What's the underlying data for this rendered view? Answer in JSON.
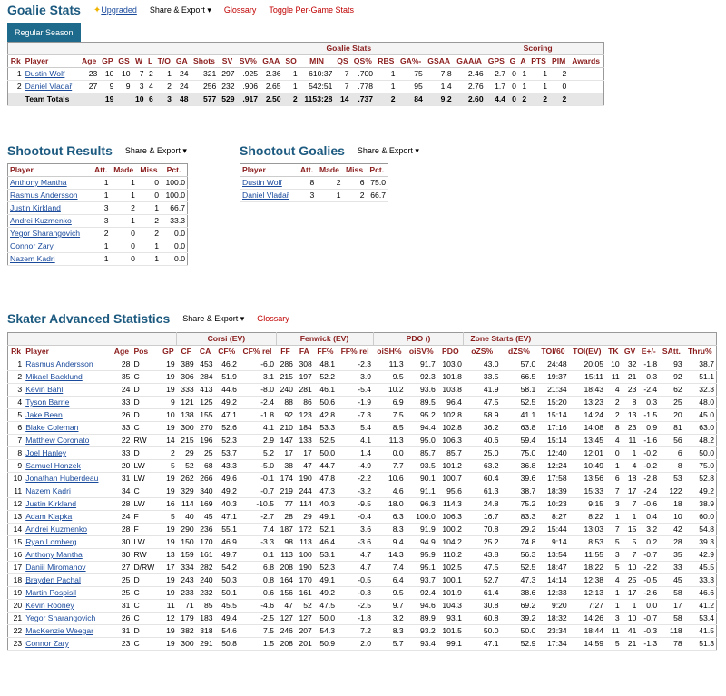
{
  "goalie": {
    "title": "Goalie Stats",
    "upgraded": "Upgraded",
    "share": "Share & Export ▾",
    "glossary": "Glossary",
    "toggle": "Toggle Per-Game Stats",
    "tab": "Regular Season",
    "group1": "Goalie Stats",
    "group2": "Scoring",
    "cols": [
      "Rk",
      "Player",
      "Age",
      "GP",
      "GS",
      "W",
      "L",
      "T/O",
      "GA",
      "Shots",
      "SV",
      "SV%",
      "GAA",
      "SO",
      "MIN",
      "QS",
      "QS%",
      "RBS",
      "GA%-",
      "GSAA",
      "GAA/A",
      "GPS",
      "G",
      "A",
      "PTS",
      "PIM",
      "Awards"
    ],
    "rows": [
      [
        "1",
        "Dustin Wolf",
        "23",
        "10",
        "10",
        "7",
        "2",
        "1",
        "24",
        "321",
        "297",
        ".925",
        "2.36",
        "1",
        "610:37",
        "7",
        ".700",
        "1",
        "75",
        "7.8",
        "2.46",
        "2.7",
        "0",
        "1",
        "1",
        "2",
        ""
      ],
      [
        "2",
        "Daniel Vladař",
        "27",
        "9",
        "9",
        "3",
        "4",
        "2",
        "24",
        "256",
        "232",
        ".906",
        "2.65",
        "1",
        "542:51",
        "7",
        ".778",
        "1",
        "95",
        "1.4",
        "2.76",
        "1.7",
        "0",
        "1",
        "1",
        "0",
        ""
      ]
    ],
    "totals": [
      "",
      "Team Totals",
      "",
      "19",
      "",
      "10",
      "6",
      "3",
      "48",
      "577",
      "529",
      ".917",
      "2.50",
      "2",
      "1153:28",
      "14",
      ".737",
      "2",
      "84",
      "9.2",
      "2.60",
      "4.4",
      "0",
      "2",
      "2",
      "2",
      ""
    ]
  },
  "shootout": {
    "title": "Shootout Results",
    "share": "Share & Export ▾",
    "cols": [
      "Player",
      "Att.",
      "Made",
      "Miss",
      "Pct."
    ],
    "rows": [
      [
        "Anthony Mantha",
        "1",
        "1",
        "0",
        "100.0"
      ],
      [
        "Rasmus Andersson",
        "1",
        "1",
        "0",
        "100.0"
      ],
      [
        "Justin Kirkland",
        "3",
        "2",
        "1",
        "66.7"
      ],
      [
        "Andrei Kuzmenko",
        "3",
        "1",
        "2",
        "33.3"
      ],
      [
        "Yegor Sharangovich",
        "2",
        "0",
        "2",
        "0.0"
      ],
      [
        "Connor Zary",
        "1",
        "0",
        "1",
        "0.0"
      ],
      [
        "Nazem Kadri",
        "1",
        "0",
        "1",
        "0.0"
      ]
    ]
  },
  "shootout_goalies": {
    "title": "Shootout Goalies",
    "share": "Share & Export ▾",
    "cols": [
      "Player",
      "Att.",
      "Made",
      "Miss",
      "Pct."
    ],
    "rows": [
      [
        "Dustin Wolf",
        "8",
        "2",
        "6",
        "75.0"
      ],
      [
        "Daniel Vladař",
        "3",
        "1",
        "2",
        "66.7"
      ]
    ]
  },
  "skater": {
    "title": "Skater Advanced Statistics",
    "share": "Share & Export ▾",
    "glossary": "Glossary",
    "groups": [
      "Corsi (EV)",
      "Fenwick (EV)",
      "PDO ()",
      "Zone Starts (EV)"
    ],
    "cols": [
      "Rk",
      "Player",
      "Age",
      "Pos",
      "GP",
      "CF",
      "CA",
      "CF%",
      "CF% rel",
      "FF",
      "FA",
      "FF%",
      "FF% rel",
      "oiSH%",
      "oiSV%",
      "PDO",
      "oZS%",
      "dZS%",
      "TOI/60",
      "TOI(EV)",
      "TK",
      "GV",
      "E+/-",
      "SAtt.",
      "Thru%"
    ],
    "rows": [
      [
        "1",
        "Rasmus Andersson",
        "28",
        "D",
        "19",
        "389",
        "453",
        "46.2",
        "-6.0",
        "286",
        "308",
        "48.1",
        "-2.3",
        "11.3",
        "91.7",
        "103.0",
        "43.0",
        "57.0",
        "24:48",
        "20:05",
        "10",
        "32",
        "-1.8",
        "93",
        "38.7"
      ],
      [
        "2",
        "Mikael Backlund",
        "35",
        "C",
        "19",
        "306",
        "284",
        "51.9",
        "3.1",
        "215",
        "197",
        "52.2",
        "3.9",
        "9.5",
        "92.3",
        "101.8",
        "33.5",
        "66.5",
        "19:37",
        "15:11",
        "11",
        "21",
        "0.3",
        "92",
        "51.1"
      ],
      [
        "3",
        "Kevin Bahl",
        "24",
        "D",
        "19",
        "333",
        "413",
        "44.6",
        "-8.0",
        "240",
        "281",
        "46.1",
        "-5.4",
        "10.2",
        "93.6",
        "103.8",
        "41.9",
        "58.1",
        "21:34",
        "18:43",
        "4",
        "23",
        "-2.4",
        "62",
        "32.3"
      ],
      [
        "4",
        "Tyson Barrie",
        "33",
        "D",
        "9",
        "121",
        "125",
        "49.2",
        "-2.4",
        "88",
        "86",
        "50.6",
        "-1.9",
        "6.9",
        "89.5",
        "96.4",
        "47.5",
        "52.5",
        "15:20",
        "13:23",
        "2",
        "8",
        "0.3",
        "25",
        "48.0"
      ],
      [
        "5",
        "Jake Bean",
        "26",
        "D",
        "10",
        "138",
        "155",
        "47.1",
        "-1.8",
        "92",
        "123",
        "42.8",
        "-7.3",
        "7.5",
        "95.2",
        "102.8",
        "58.9",
        "41.1",
        "15:14",
        "14:24",
        "2",
        "13",
        "-1.5",
        "20",
        "45.0"
      ],
      [
        "6",
        "Blake Coleman",
        "33",
        "C",
        "19",
        "300",
        "270",
        "52.6",
        "4.1",
        "210",
        "184",
        "53.3",
        "5.4",
        "8.5",
        "94.4",
        "102.8",
        "36.2",
        "63.8",
        "17:16",
        "14:08",
        "8",
        "23",
        "0.9",
        "81",
        "63.0"
      ],
      [
        "7",
        "Matthew Coronato",
        "22",
        "RW",
        "14",
        "215",
        "196",
        "52.3",
        "2.9",
        "147",
        "133",
        "52.5",
        "4.1",
        "11.3",
        "95.0",
        "106.3",
        "40.6",
        "59.4",
        "15:14",
        "13:45",
        "4",
        "11",
        "-1.6",
        "56",
        "48.2"
      ],
      [
        "8",
        "Joel Hanley",
        "33",
        "D",
        "2",
        "29",
        "25",
        "53.7",
        "5.2",
        "17",
        "17",
        "50.0",
        "1.4",
        "0.0",
        "85.7",
        "85.7",
        "25.0",
        "75.0",
        "12:40",
        "12:01",
        "0",
        "1",
        "-0.2",
        "6",
        "50.0"
      ],
      [
        "9",
        "Samuel Honzek",
        "20",
        "LW",
        "5",
        "52",
        "68",
        "43.3",
        "-5.0",
        "38",
        "47",
        "44.7",
        "-4.9",
        "7.7",
        "93.5",
        "101.2",
        "63.2",
        "36.8",
        "12:24",
        "10:49",
        "1",
        "4",
        "-0.2",
        "8",
        "75.0"
      ],
      [
        "10",
        "Jonathan Huberdeau",
        "31",
        "LW",
        "19",
        "262",
        "266",
        "49.6",
        "-0.1",
        "174",
        "190",
        "47.8",
        "-2.2",
        "10.6",
        "90.1",
        "100.7",
        "60.4",
        "39.6",
        "17:58",
        "13:56",
        "6",
        "18",
        "-2.8",
        "53",
        "52.8"
      ],
      [
        "11",
        "Nazem Kadri",
        "34",
        "C",
        "19",
        "329",
        "340",
        "49.2",
        "-0.7",
        "219",
        "244",
        "47.3",
        "-3.2",
        "4.6",
        "91.1",
        "95.6",
        "61.3",
        "38.7",
        "18:39",
        "15:33",
        "7",
        "17",
        "-2.4",
        "122",
        "49.2"
      ],
      [
        "12",
        "Justin Kirkland",
        "28",
        "LW",
        "16",
        "114",
        "169",
        "40.3",
        "-10.5",
        "77",
        "114",
        "40.3",
        "-9.5",
        "18.0",
        "96.3",
        "114.3",
        "24.8",
        "75.2",
        "10:23",
        "9:15",
        "3",
        "7",
        "-0.6",
        "18",
        "38.9"
      ],
      [
        "13",
        "Adam Klapka",
        "24",
        "F",
        "5",
        "40",
        "45",
        "47.1",
        "-2.7",
        "28",
        "29",
        "49.1",
        "-0.4",
        "6.3",
        "100.0",
        "106.3",
        "16.7",
        "83.3",
        "8:27",
        "8:22",
        "1",
        "1",
        "0.4",
        "10",
        "60.0"
      ],
      [
        "14",
        "Andrei Kuzmenko",
        "28",
        "F",
        "19",
        "290",
        "236",
        "55.1",
        "7.4",
        "187",
        "172",
        "52.1",
        "3.6",
        "8.3",
        "91.9",
        "100.2",
        "70.8",
        "29.2",
        "15:44",
        "13:03",
        "7",
        "15",
        "3.2",
        "42",
        "54.8"
      ],
      [
        "15",
        "Ryan Lomberg",
        "30",
        "LW",
        "19",
        "150",
        "170",
        "46.9",
        "-3.3",
        "98",
        "113",
        "46.4",
        "-3.6",
        "9.4",
        "94.9",
        "104.2",
        "25.2",
        "74.8",
        "9:14",
        "8:53",
        "5",
        "5",
        "0.2",
        "28",
        "39.3"
      ],
      [
        "16",
        "Anthony Mantha",
        "30",
        "RW",
        "13",
        "159",
        "161",
        "49.7",
        "0.1",
        "113",
        "100",
        "53.1",
        "4.7",
        "14.3",
        "95.9",
        "110.2",
        "43.8",
        "56.3",
        "13:54",
        "11:55",
        "3",
        "7",
        "-0.7",
        "35",
        "42.9"
      ],
      [
        "17",
        "Daniil Miromanov",
        "27",
        "D/RW",
        "17",
        "334",
        "282",
        "54.2",
        "6.8",
        "208",
        "190",
        "52.3",
        "4.7",
        "7.4",
        "95.1",
        "102.5",
        "47.5",
        "52.5",
        "18:47",
        "18:22",
        "5",
        "10",
        "-2.2",
        "33",
        "45.5"
      ],
      [
        "18",
        "Brayden Pachal",
        "25",
        "D",
        "19",
        "243",
        "240",
        "50.3",
        "0.8",
        "164",
        "170",
        "49.1",
        "-0.5",
        "6.4",
        "93.7",
        "100.1",
        "52.7",
        "47.3",
        "14:14",
        "12:38",
        "4",
        "25",
        "-0.5",
        "45",
        "33.3"
      ],
      [
        "19",
        "Martin Pospisil",
        "25",
        "C",
        "19",
        "233",
        "232",
        "50.1",
        "0.6",
        "156",
        "161",
        "49.2",
        "-0.3",
        "9.5",
        "92.4",
        "101.9",
        "61.4",
        "38.6",
        "12:33",
        "12:13",
        "1",
        "17",
        "-2.6",
        "58",
        "46.6"
      ],
      [
        "20",
        "Kevin Rooney",
        "31",
        "C",
        "11",
        "71",
        "85",
        "45.5",
        "-4.6",
        "47",
        "52",
        "47.5",
        "-2.5",
        "9.7",
        "94.6",
        "104.3",
        "30.8",
        "69.2",
        "9:20",
        "7:27",
        "1",
        "1",
        "0.0",
        "17",
        "41.2"
      ],
      [
        "21",
        "Yegor Sharangovich",
        "26",
        "C",
        "12",
        "179",
        "183",
        "49.4",
        "-2.5",
        "127",
        "127",
        "50.0",
        "-1.8",
        "3.2",
        "89.9",
        "93.1",
        "60.8",
        "39.2",
        "18:32",
        "14:26",
        "3",
        "10",
        "-0.7",
        "58",
        "53.4"
      ],
      [
        "22",
        "MacKenzie Weegar",
        "31",
        "D",
        "19",
        "382",
        "318",
        "54.6",
        "7.5",
        "246",
        "207",
        "54.3",
        "7.2",
        "8.3",
        "93.2",
        "101.5",
        "50.0",
        "50.0",
        "23:34",
        "18:44",
        "11",
        "41",
        "-0.3",
        "118",
        "41.5"
      ],
      [
        "23",
        "Connor Zary",
        "23",
        "C",
        "19",
        "300",
        "291",
        "50.8",
        "1.5",
        "208",
        "201",
        "50.9",
        "2.0",
        "5.7",
        "93.4",
        "99.1",
        "47.1",
        "52.9",
        "17:34",
        "14:59",
        "5",
        "21",
        "-1.3",
        "78",
        "51.3"
      ]
    ]
  }
}
